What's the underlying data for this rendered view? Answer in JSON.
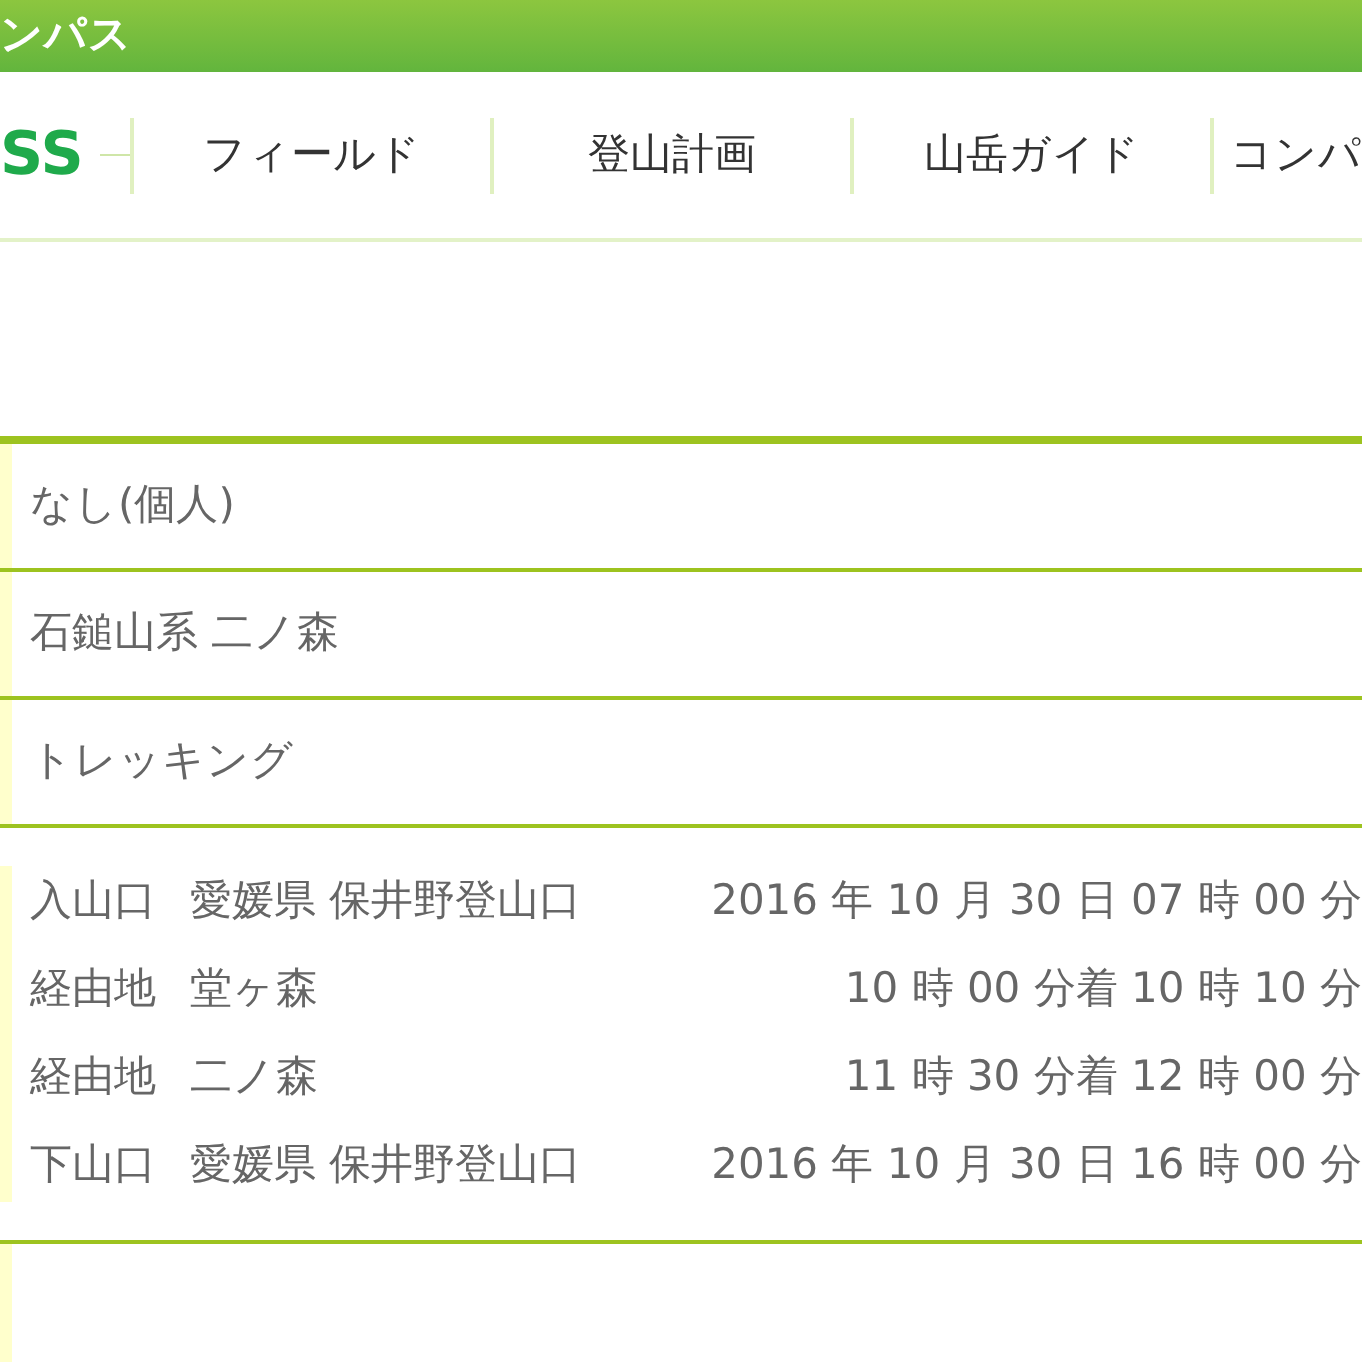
{
  "header": {
    "title": "ンパス"
  },
  "nav": {
    "logo": "SS",
    "items": [
      {
        "label": "フィールド"
      },
      {
        "label": "登山計画"
      },
      {
        "label": "山岳ガイド"
      },
      {
        "label": "コンパ"
      }
    ]
  },
  "rows": [
    {
      "kind": "text",
      "value": "なし(個人)"
    },
    {
      "kind": "text",
      "value": "石鎚山系 二ノ森"
    },
    {
      "kind": "text",
      "value": "トレッキング"
    },
    {
      "kind": "route",
      "stops": [
        {
          "type": "入山口",
          "place": "愛媛県 保井野登山口",
          "time": "2016 年 10 月 30 日 07 時 00 分"
        },
        {
          "type": "経由地",
          "place": "堂ヶ森",
          "time": "10 時 00 分着 10 時 10 分"
        },
        {
          "type": "経由地",
          "place": "二ノ森",
          "time": "11 時 30 分着 12 時 00 分"
        },
        {
          "type": "下山口",
          "place": "愛媛県 保井野登山口",
          "time": "2016 年 10 月 30 日 16 時 00 分"
        }
      ]
    },
    {
      "kind": "empty"
    }
  ]
}
